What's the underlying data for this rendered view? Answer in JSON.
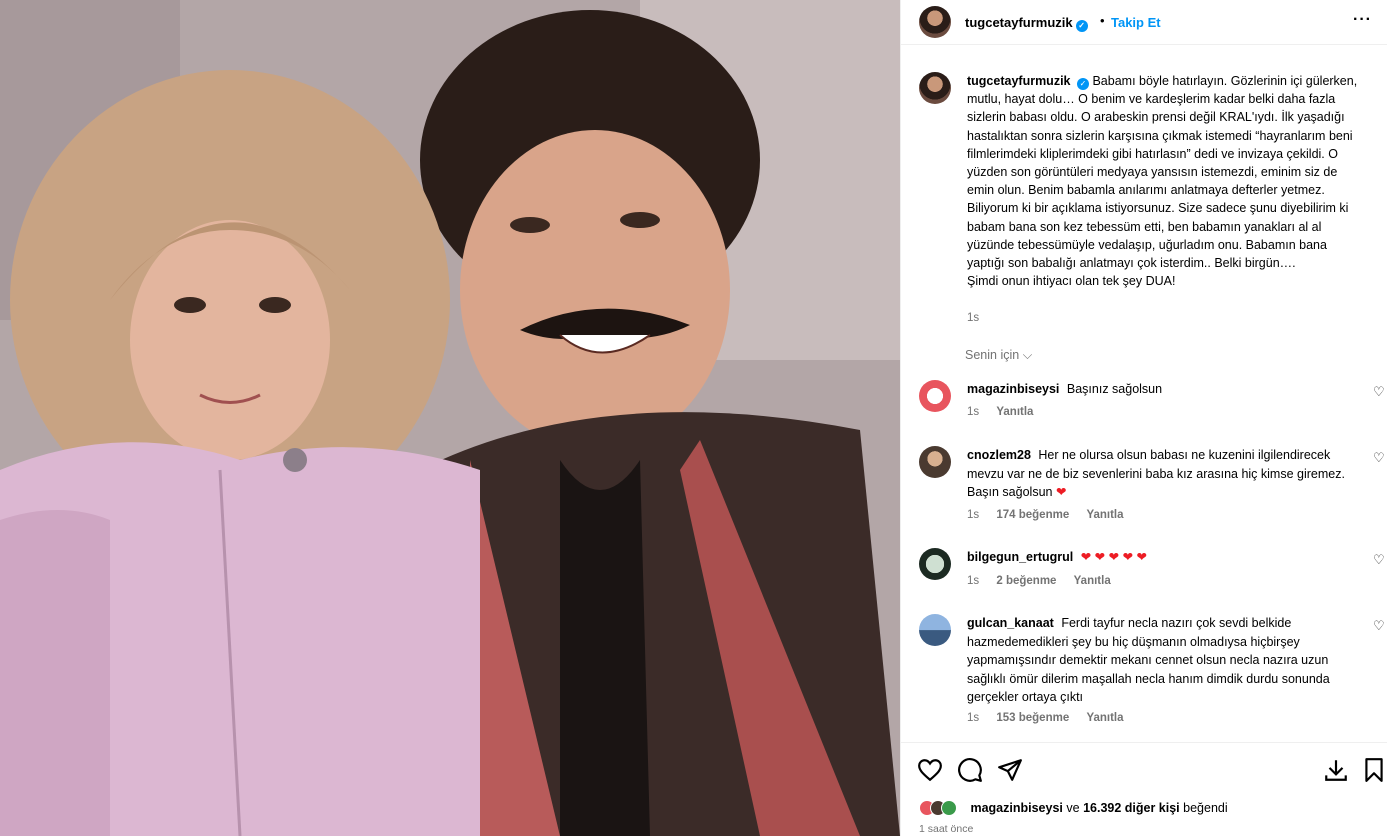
{
  "post": {
    "owner": "tugcetayfurmuzik",
    "separator": "•",
    "follow_label": "Takip Et",
    "more_icon": "more-horizontal-icon"
  },
  "caption": {
    "user": "tugcetayfurmuzik",
    "text": "Babamı böyle hatırlayın. Gözlerinin içi gülerken, mutlu, hayat dolu… O benim ve kardeşlerim kadar belki daha fazla sizlerin babası oldu. O arabeskin prensi değil KRAL'ıydı. İlk yaşadığı hastalıktan sonra sizlerin karşısına çıkmak istemedi “hayranlarım beni filmlerimdeki kliplerimdeki gibi hatırlasın” dedi ve invizaya çekildi. O yüzden son görüntüleri medyaya yansısın istemezdi, eminim siz de emin olun. Benim babamla anılarımı anlatmaya defterler yetmez. Biliyorum ki bir açıklama istiyorsunuz. Size sadece şunu diyebilirim ki babam bana son kez tebessüm etti, ben babamın yanakları al al yüzünde tebessümüyle vedalaşıp, uğurladım onu. Babamın bana yaptığı son babalığı anlatmayı çok isterdim.. Belki birgün….",
    "last_line": "Şimdi onun ihtiyacı olan tek şey DUA!",
    "time": "1s"
  },
  "filter_label": "Senin için",
  "comments": [
    {
      "user": "magazinbiseysi",
      "text": "Başınız sağolsun",
      "time": "1s",
      "likes": "",
      "reply": "Yanıtla"
    },
    {
      "user": "cnozlem28",
      "text": "Her ne olursa olsun babası ne kuzenini ilgilendirecek mevzu var ne de biz sevenlerini baba kız arasına hiç kimse giremez. Başın sağolsun",
      "time": "1s",
      "likes": "174 beğenme",
      "reply": "Yanıtla"
    },
    {
      "user": "bilgegun_ertugrul",
      "text": "",
      "time": "1s",
      "likes": "2 beğenme",
      "reply": "Yanıtla"
    },
    {
      "user": "gulcan_kanaat",
      "text": "Ferdi tayfur necla nazırı çok sevdi belkide hazmedemedikleri şey bu hiç düşmanın olmadıysa hiçbirşey yapmamışsındır demektir mekanı cennet olsun necla nazıra uzun sağlıklı ömür dilerim maşallah necla hanım dimdik durdu sonunda gerçekler ortaya çıktı",
      "time": "1s",
      "likes": "153 beğenme",
      "reply": "Yanıtla"
    }
  ],
  "likes": {
    "first_user": "magazinbiseysi",
    "connector": "ve",
    "others": "16.392 diğer kişi",
    "suffix": "beğendi"
  },
  "post_time": "1 saat önce",
  "colors": {
    "accent": "#0095f6",
    "heart": "#ed1c24",
    "muted": "#737373"
  }
}
